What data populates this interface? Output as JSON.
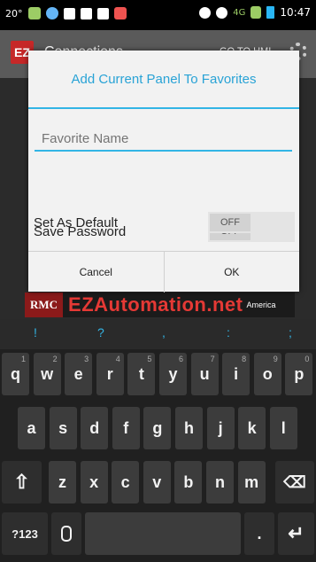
{
  "status_bar": {
    "temperature": "20°",
    "time": "10:47",
    "network": "4G"
  },
  "app_bar": {
    "title": "Connections",
    "go_to_hmi": "GO TO HMI"
  },
  "banner": {
    "rmc": "RMC",
    "brand": "EZAutomation.net",
    "tag": "America"
  },
  "dialog": {
    "title": "Add Current Panel To Favorites",
    "favorite_name_placeholder": "Favorite Name",
    "favorite_name_value": "",
    "save_password_label": "Save Password",
    "save_password_state": "OFF",
    "set_default_label": "Set As Default",
    "set_default_state": "OFF",
    "cancel_label": "Cancel",
    "ok_label": "OK"
  },
  "keyboard": {
    "suggestions": [
      "!",
      "?",
      ",",
      ":",
      ";"
    ],
    "row1": [
      {
        "key": "q",
        "sub": "1"
      },
      {
        "key": "w",
        "sub": "2"
      },
      {
        "key": "e",
        "sub": "3"
      },
      {
        "key": "r",
        "sub": "4"
      },
      {
        "key": "t",
        "sub": "5"
      },
      {
        "key": "y",
        "sub": "6"
      },
      {
        "key": "u",
        "sub": "7"
      },
      {
        "key": "i",
        "sub": "8"
      },
      {
        "key": "o",
        "sub": "9"
      },
      {
        "key": "p",
        "sub": "0"
      }
    ],
    "row2": [
      "a",
      "s",
      "d",
      "f",
      "g",
      "h",
      "j",
      "k",
      "l"
    ],
    "row3": [
      "z",
      "x",
      "c",
      "v",
      "b",
      "n",
      "m"
    ],
    "shift_icon": "⇧",
    "delete_icon": "⌫",
    "numbers_label": "?123",
    "mic_icon": "mic-icon",
    "period": ".",
    "enter_icon": "↵"
  }
}
